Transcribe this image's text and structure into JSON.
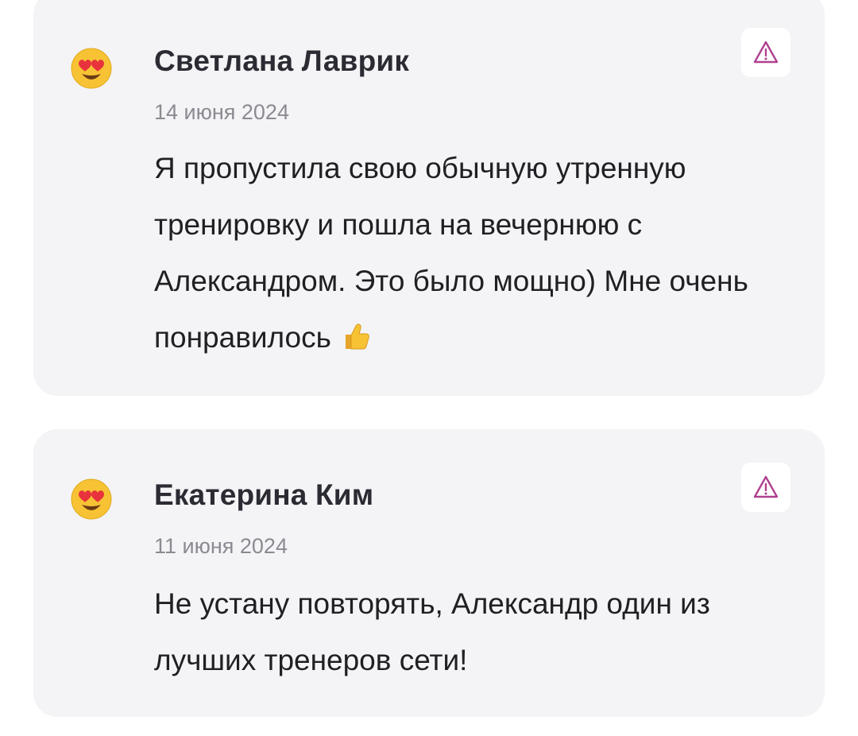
{
  "reviews": [
    {
      "avatar_icon": "heart-eyes-emoji-icon",
      "author": "Светлана Лаврик",
      "date": "14 июня 2024",
      "text": "Я пропустила свою обычную утренную тренировку и пошла на вечернюю с Александром. Это было мощно) Мне очень понравилось",
      "trailing_icon": "thumbs-up-emoji-icon",
      "report_icon": "warning-triangle-icon"
    },
    {
      "avatar_icon": "heart-eyes-emoji-icon",
      "author": "Екатерина Ким",
      "date": "11 июня 2024",
      "text": "Не устану повторять, Александр один из лучших тренеров сети!",
      "report_icon": "warning-triangle-icon"
    }
  ],
  "colors": {
    "card_background": "#f4f4f6",
    "author_text": "#2b2b33",
    "date_text": "#8a8a92",
    "body_text": "#1f1f24",
    "report_icon": "#b0418f"
  }
}
